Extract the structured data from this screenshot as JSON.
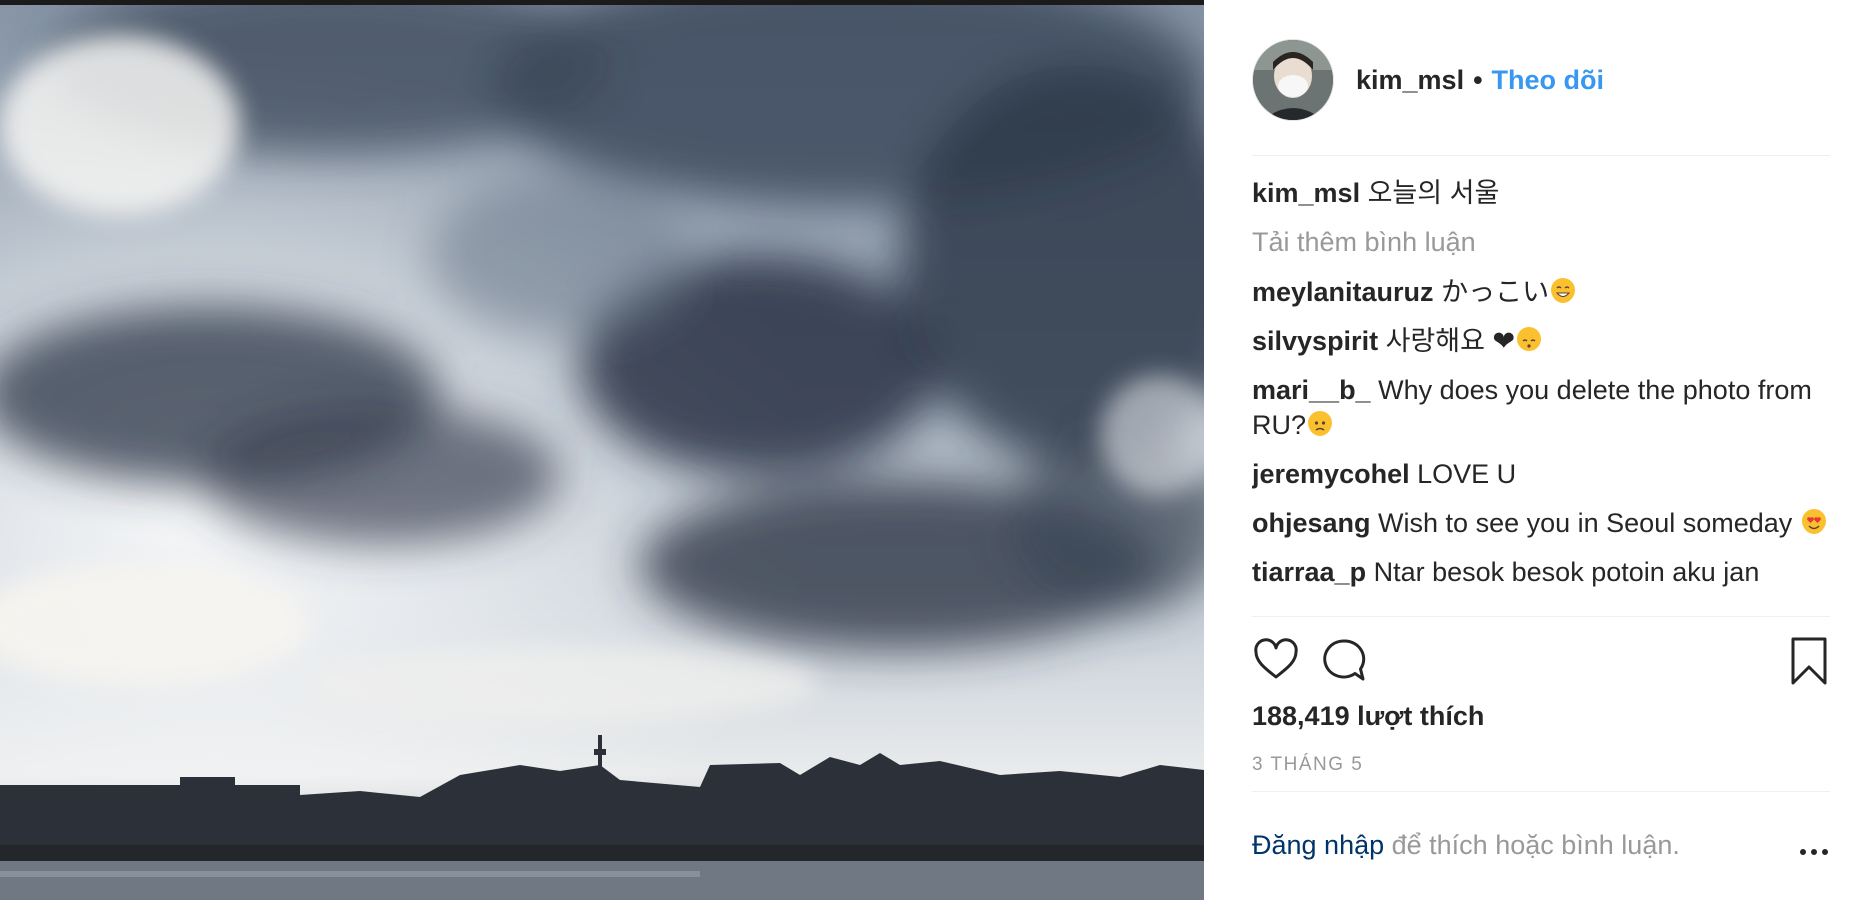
{
  "post": {
    "author": "kim_msl",
    "follow_label": "Theo dõi",
    "caption": "오늘의 서울",
    "load_more_label": "Tải thêm bình luận",
    "comments": [
      {
        "user": "meylanitauruz",
        "text": "かっこい",
        "emoji": "grinning-face"
      },
      {
        "user": "silvyspirit",
        "text": "사랑해요 ❤",
        "emoji": "kissing-cat-face"
      },
      {
        "user": "mari__b_",
        "text": "Why does you delete the photo from RU?",
        "emoji": "slightly-frowning-face"
      },
      {
        "user": "jeremycohel",
        "text": "LOVE U"
      },
      {
        "user": "ohjesang",
        "text": "Wish to see you in Seoul someday",
        "emoji": "heart-eyes-face"
      },
      {
        "user": "tiarraa_p",
        "text": "Ntar besok besok potoin aku jan"
      }
    ],
    "likes_text": "188,419 lượt thích",
    "date_text": "3 THÁNG 5",
    "login_link": "Đăng nhập",
    "login_suffix": " để thích hoặc bình luận."
  },
  "icons": {
    "like": "heart-outline-icon",
    "comment": "speech-bubble-icon",
    "save": "bookmark-icon",
    "more": "more-options-icon"
  },
  "colors": {
    "follow_blue": "#3897f0",
    "login_navy": "#003569",
    "muted_gray": "#999999",
    "text_dark": "#262626"
  }
}
